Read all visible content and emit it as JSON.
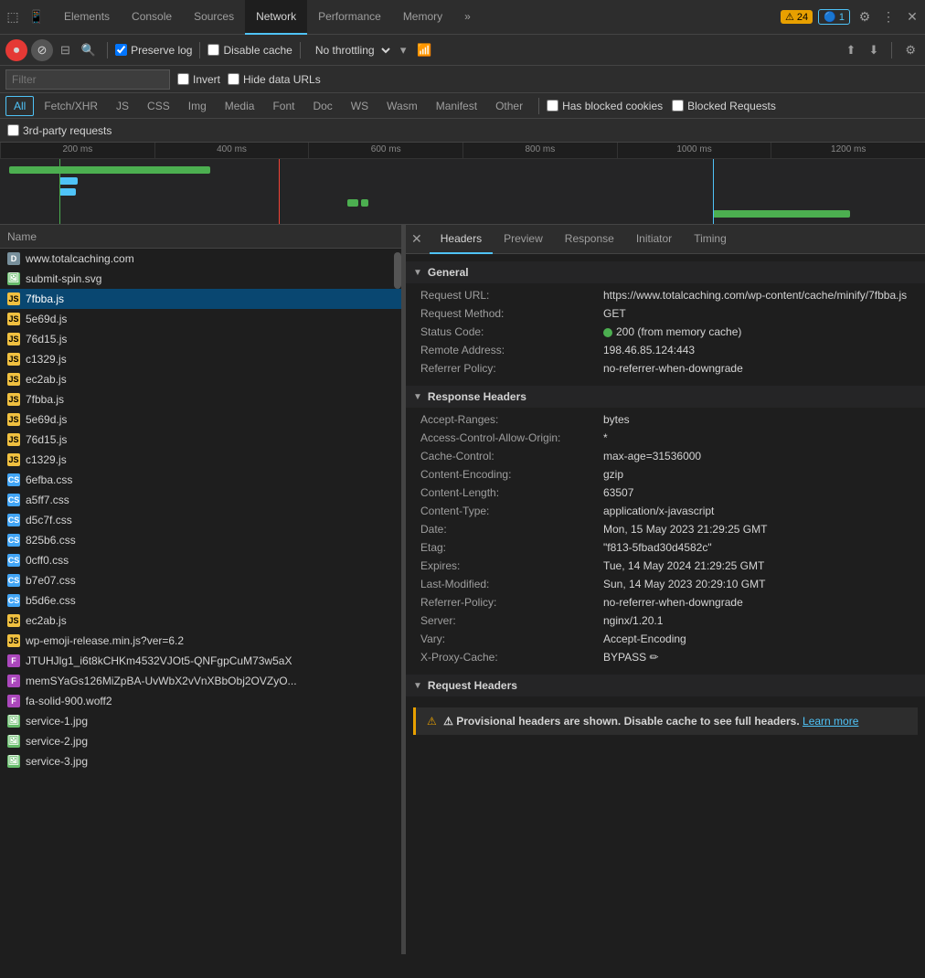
{
  "tabs": [
    {
      "label": "Elements",
      "active": false
    },
    {
      "label": "Console",
      "active": false
    },
    {
      "label": "Sources",
      "active": false
    },
    {
      "label": "Network",
      "active": true
    },
    {
      "label": "Performance",
      "active": false
    },
    {
      "label": "Memory",
      "active": false
    },
    {
      "label": "»",
      "active": false
    }
  ],
  "badges": {
    "warning": "⚠ 24",
    "info": "🔵 1"
  },
  "toolbar": {
    "preserve_log": "Preserve log",
    "disable_cache": "Disable cache",
    "throttle": "No throttling"
  },
  "filter": {
    "placeholder": "Filter",
    "invert": "Invert",
    "hide_data_urls": "Hide data URLs"
  },
  "type_filters": [
    "All",
    "Fetch/XHR",
    "JS",
    "CSS",
    "Img",
    "Media",
    "Font",
    "Doc",
    "WS",
    "Wasm",
    "Manifest",
    "Other"
  ],
  "type_filters_right": [
    "Has blocked cookies",
    "Blocked Requests"
  ],
  "third_party": "3rd-party requests",
  "timeline": {
    "ticks": [
      "200 ms",
      "400 ms",
      "600 ms",
      "800 ms",
      "1000 ms",
      "1200 ms"
    ]
  },
  "columns": {
    "name": "Name"
  },
  "files": [
    {
      "name": "www.totalcaching.com",
      "type": "doc",
      "selected": false
    },
    {
      "name": "submit-spin.svg",
      "type": "img",
      "selected": false
    },
    {
      "name": "7fbba.js",
      "type": "js",
      "selected": true
    },
    {
      "name": "5e69d.js",
      "type": "js",
      "selected": false
    },
    {
      "name": "76d15.js",
      "type": "js",
      "selected": false
    },
    {
      "name": "c1329.js",
      "type": "js",
      "selected": false
    },
    {
      "name": "ec2ab.js",
      "type": "js",
      "selected": false
    },
    {
      "name": "7fbba.js",
      "type": "js",
      "selected": false
    },
    {
      "name": "5e69d.js",
      "type": "js",
      "selected": false
    },
    {
      "name": "76d15.js",
      "type": "js",
      "selected": false
    },
    {
      "name": "c1329.js",
      "type": "js",
      "selected": false
    },
    {
      "name": "6efba.css",
      "type": "css",
      "selected": false
    },
    {
      "name": "a5ff7.css",
      "type": "css",
      "selected": false
    },
    {
      "name": "d5c7f.css",
      "type": "css",
      "selected": false
    },
    {
      "name": "825b6.css",
      "type": "css",
      "selected": false
    },
    {
      "name": "0cff0.css",
      "type": "css",
      "selected": false
    },
    {
      "name": "b7e07.css",
      "type": "css",
      "selected": false
    },
    {
      "name": "b5d6e.css",
      "type": "css",
      "selected": false
    },
    {
      "name": "ec2ab.js",
      "type": "js",
      "selected": false
    },
    {
      "name": "wp-emoji-release.min.js?ver=6.2",
      "type": "js",
      "selected": false
    },
    {
      "name": "JTUHJlg1_i6t8kCHKm4532VJOt5-QNFgpCuM73w5aX",
      "type": "font",
      "selected": false
    },
    {
      "name": "memSYaGs126MiZpBA-UvWbX2vVnXBbObj2OVZyO...",
      "type": "font",
      "selected": false
    },
    {
      "name": "fa-solid-900.woff2",
      "type": "font",
      "selected": false
    },
    {
      "name": "service-1.jpg",
      "type": "img",
      "selected": false
    },
    {
      "name": "service-2.jpg",
      "type": "img",
      "selected": false
    },
    {
      "name": "service-3.jpg",
      "type": "img",
      "selected": false
    }
  ],
  "detail": {
    "tabs": [
      "Headers",
      "Preview",
      "Response",
      "Initiator",
      "Timing"
    ],
    "active_tab": "Headers",
    "sections": {
      "general": {
        "title": "General",
        "rows": [
          {
            "key": "Request URL:",
            "value": "https://www.totalcaching.com/wp-content/cache/minify/7fbba.js"
          },
          {
            "key": "Request Method:",
            "value": "GET"
          },
          {
            "key": "Status Code:",
            "value": "200 (from memory cache)",
            "has_dot": true
          },
          {
            "key": "Remote Address:",
            "value": "198.46.85.124:443"
          },
          {
            "key": "Referrer Policy:",
            "value": "no-referrer-when-downgrade"
          }
        ]
      },
      "response_headers": {
        "title": "Response Headers",
        "rows": [
          {
            "key": "Accept-Ranges:",
            "value": "bytes"
          },
          {
            "key": "Access-Control-Allow-Origin:",
            "value": "*"
          },
          {
            "key": "Cache-Control:",
            "value": "max-age=31536000"
          },
          {
            "key": "Content-Encoding:",
            "value": "gzip"
          },
          {
            "key": "Content-Length:",
            "value": "63507"
          },
          {
            "key": "Content-Type:",
            "value": "application/x-javascript"
          },
          {
            "key": "Date:",
            "value": "Mon, 15 May 2023 21:29:25 GMT"
          },
          {
            "key": "Etag:",
            "value": "\"f813-5fbad30d4582c\""
          },
          {
            "key": "Expires:",
            "value": "Tue, 14 May 2024 21:29:25 GMT"
          },
          {
            "key": "Last-Modified:",
            "value": "Sun, 14 May 2023 20:29:10 GMT"
          },
          {
            "key": "Referrer-Policy:",
            "value": "no-referrer-when-downgrade"
          },
          {
            "key": "Server:",
            "value": "nginx/1.20.1"
          },
          {
            "key": "Vary:",
            "value": "Accept-Encoding"
          },
          {
            "key": "X-Proxy-Cache:",
            "value": "BYPASS ✏"
          }
        ]
      },
      "request_headers": {
        "title": "Request Headers",
        "warning": "⚠ Provisional headers are shown. Disable cache to see full headers.",
        "warning_link": "Learn more"
      }
    }
  }
}
